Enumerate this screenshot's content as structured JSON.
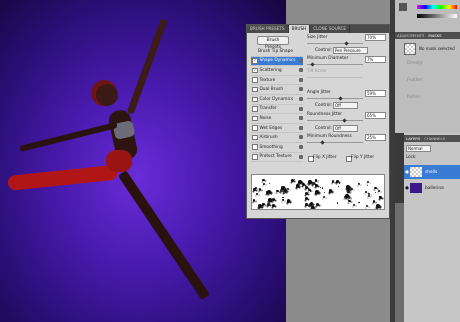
{
  "brush_panel": {
    "tabs": [
      "BRUSH PRESETS",
      "BRUSH",
      "CLONE SOURCE"
    ],
    "presets_button": "Brush Presets",
    "options": [
      {
        "label": "Brush Tip Shape",
        "checked": false,
        "selected": false,
        "checkbox": false
      },
      {
        "label": "Shape Dynamics",
        "checked": true,
        "selected": true,
        "checkbox": true
      },
      {
        "label": "Scattering",
        "checked": true,
        "selected": false,
        "checkbox": true
      },
      {
        "label": "Texture",
        "checked": false,
        "selected": false,
        "checkbox": true
      },
      {
        "label": "Dual Brush",
        "checked": false,
        "selected": false,
        "checkbox": true
      },
      {
        "label": "Color Dynamics",
        "checked": false,
        "selected": false,
        "checkbox": true
      },
      {
        "label": "Transfer",
        "checked": false,
        "selected": false,
        "checkbox": true
      },
      {
        "label": "Noise",
        "checked": false,
        "selected": false,
        "checkbox": true
      },
      {
        "label": "Wet Edges",
        "checked": false,
        "selected": false,
        "checkbox": true
      },
      {
        "label": "Airbrush",
        "checked": false,
        "selected": false,
        "checkbox": true
      },
      {
        "label": "Smoothing",
        "checked": false,
        "selected": false,
        "checkbox": true
      },
      {
        "label": "Protect Texture",
        "checked": false,
        "selected": false,
        "checkbox": true
      }
    ],
    "size_jitter": {
      "label": "Size Jitter",
      "value": "70%"
    },
    "control1": {
      "label": "Control:",
      "value": "Pen Pressure"
    },
    "min_diameter": {
      "label": "Minimum Diameter",
      "value": "7%"
    },
    "tilt_scale": {
      "label": "Tilt Scale"
    },
    "angle_jitter": {
      "label": "Angle Jitter",
      "value": "59%"
    },
    "control2": {
      "label": "Control:",
      "value": "Off"
    },
    "roundness_jitter": {
      "label": "Roundness Jitter",
      "value": "65%"
    },
    "control3": {
      "label": "Control:",
      "value": "Off"
    },
    "min_roundness": {
      "label": "Minimum Roundness",
      "value": "25%"
    },
    "flip_x": "Flip X Jitter",
    "flip_y": "Flip Y Jitter"
  },
  "masks_panel": {
    "tabs": [
      "ADJUSTMENTS",
      "MASKS"
    ],
    "no_mask": "No mask selected",
    "density": "Density:",
    "feather": "Feather:",
    "refine": "Refine:"
  },
  "layers_panel": {
    "tabs": [
      "LAYERS",
      "CHANNELS"
    ],
    "blend_mode": "Normal",
    "lock_label": "Lock:",
    "layers": [
      {
        "name": "shells",
        "selected": true
      },
      {
        "name": "ballerina",
        "selected": false
      }
    ]
  },
  "colors": {
    "canvas": "#4a1bb0",
    "selection": "#3a7bd5"
  }
}
